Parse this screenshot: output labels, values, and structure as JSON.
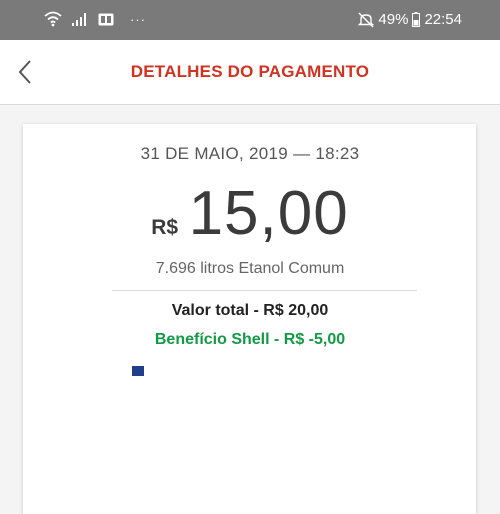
{
  "status_bar": {
    "battery": "49%",
    "time": "22:54",
    "dots": "···",
    "icons": [
      "wifi-icon",
      "signal-icon",
      "sim-card-icon",
      "mute-icon",
      "battery-icon"
    ]
  },
  "header": {
    "title": "DETALHES DO PAGAMENTO",
    "back_icon": "chevron-left-icon"
  },
  "payment": {
    "date": "31 DE MAIO, 2019 — 18:23",
    "currency": "R$",
    "amount": "15,00",
    "fuel": "7.696 litros Etanol Comum",
    "total": "Valor total - R$ 20,00",
    "benefit": "Benefício Shell - R$ -5,00"
  },
  "colors": {
    "title": "#d2321f",
    "benefit": "#139a44",
    "status_bar": "#7a7a7a"
  }
}
